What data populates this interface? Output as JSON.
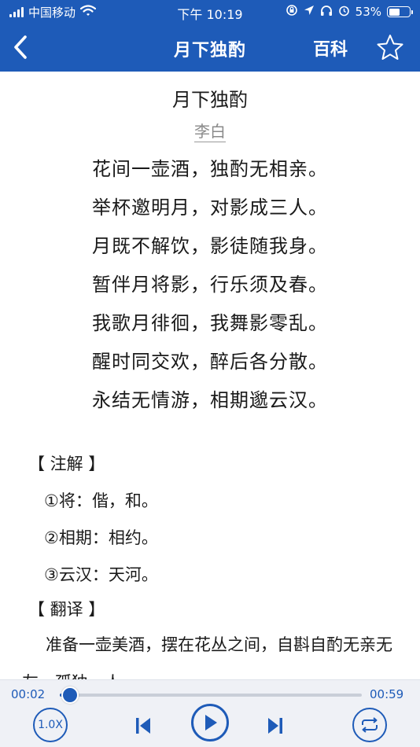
{
  "status_bar": {
    "carrier": "中国移动",
    "time": "下午 10:19",
    "battery_text": "53%",
    "battery_level": 0.53,
    "icons": [
      "signal-icon",
      "wifi-icon",
      "orientation-lock-icon",
      "location-icon",
      "headphones-icon",
      "alarm-icon",
      "battery-icon"
    ]
  },
  "nav": {
    "back_icon": "chevron-left-icon",
    "title": "月下独酌",
    "baike_label": "百科",
    "favorite_icon": "star-outline-icon"
  },
  "poem": {
    "title": "月下独酌",
    "author": "李白",
    "lines": [
      "花间一壶酒，独酌无相亲。",
      "举杯邀明月，对影成三人。",
      "月既不解饮，影徒随我身。",
      "暂伴月将影，行乐须及春。",
      "我歌月徘徊，我舞影零乱。",
      "醒时同交欢，醉后各分散。",
      "永结无情游，相期邈云汉。"
    ]
  },
  "notes": {
    "heading": "【 注解 】",
    "items": [
      "①将：偕，和。",
      "②相期：相约。",
      "③云汉：天河。"
    ]
  },
  "translation": {
    "heading": "【 翻译 】",
    "text": "准备一壶美酒，摆在花丛之间，自斟自酌无亲无友，孤独一人。"
  },
  "player": {
    "current_time": "00:02",
    "total_time": "00:59",
    "progress": 0.034,
    "speed_label": "1.0X",
    "accent_color": "#1e5bb8",
    "icons": [
      "skip-previous-icon",
      "play-icon",
      "skip-next-icon",
      "repeat-icon"
    ]
  }
}
